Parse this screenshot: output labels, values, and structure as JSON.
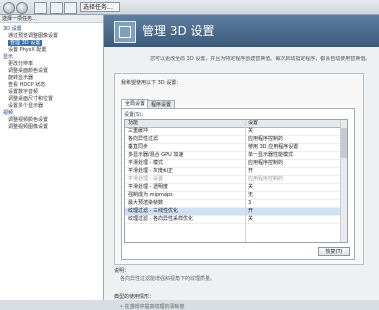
{
  "toolbar": {
    "task_label": "选择任务…"
  },
  "sidebar": {
    "header": "选择一项任务…",
    "items": [
      {
        "label": "3D 设置",
        "level": 1
      },
      {
        "label": "通过预览调整图像设置",
        "level": 2
      },
      {
        "label": "管理 3D 设置",
        "level": 2,
        "selected": true
      },
      {
        "label": "设置 PhysX 配置",
        "level": 2
      },
      {
        "label": "显示",
        "level": 1
      },
      {
        "label": "更改分辨率",
        "level": 2
      },
      {
        "label": "调整桌面颜色设置",
        "level": 2
      },
      {
        "label": "旋转显示器",
        "level": 2
      },
      {
        "label": "查看 HDCP 状态",
        "level": 2
      },
      {
        "label": "设置数字音频",
        "level": 2
      },
      {
        "label": "调整桌面尺寸和位置",
        "level": 2
      },
      {
        "label": "设置多个显示器",
        "level": 2
      },
      {
        "label": "视频",
        "level": 1
      },
      {
        "label": "调整视频颜色设置",
        "level": 2
      },
      {
        "label": "调整视频图像设置",
        "level": 2
      }
    ]
  },
  "main": {
    "title": "管理 3D 设置",
    "description": "您可以更改全局 3D 设置，并且为特定程序创建替换值。每次启动指定程序，都会自动使用替换值。",
    "section_label": "我希望使用以下 3D 设置：",
    "tabs": [
      {
        "label": "全局设置",
        "active": true
      },
      {
        "label": "程序设置",
        "active": false
      }
    ],
    "settings_label": "设置(S)：",
    "columns": [
      "功能",
      "设置"
    ],
    "rows": [
      {
        "feature": "三重缓冲",
        "value": "关"
      },
      {
        "feature": "各向异性过滤",
        "value": "应用程序控制的"
      },
      {
        "feature": "垂直同步",
        "value": "使用 3D 应用程序设置"
      },
      {
        "feature": "多显示器/混合 GPU 加速",
        "value": "单一显示器性能模式"
      },
      {
        "feature": "平滑处理 - 模式",
        "value": "应用程序控制的"
      },
      {
        "feature": "平滑处理 - 灰度纠正",
        "value": "开"
      },
      {
        "feature": "平滑处理 - 设置",
        "value": "应用程序控制的",
        "dim": true
      },
      {
        "feature": "平滑处理 - 透明度",
        "value": "关"
      },
      {
        "feature": "强制成为 mipmaps",
        "value": "无"
      },
      {
        "feature": "最大预渲染帧数",
        "value": "3"
      },
      {
        "feature": "纹理过滤 - 三线性优化",
        "value": "开",
        "selected": true
      },
      {
        "feature": "纹理过滤 - 各向异性采样优化",
        "value": "关"
      }
    ],
    "restore_label": "恢复(T)",
    "footer_desc_label": "说明：",
    "footer_desc_text": "各向异性过滤能增强斜视角下的纹理质量。",
    "footer_usage_label": "典型的使用情形：",
    "footer_usage_text": "• 在游戏中提高纹理的清晰度"
  }
}
